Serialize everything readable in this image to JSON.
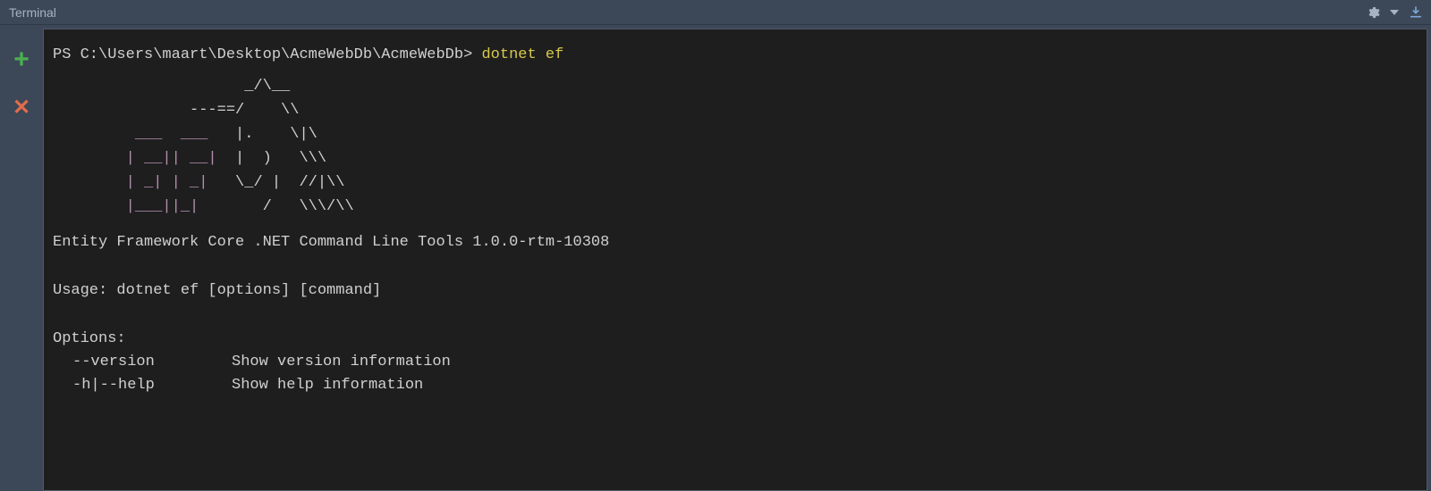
{
  "title": "Terminal",
  "prompt": "PS C:\\Users\\maart\\Desktop\\AcmeWebDb\\AcmeWebDb> ",
  "command": "dotnet ef",
  "ascii": {
    "lines": [
      {
        "plain": "                     _/\\__"
      },
      {
        "plain": "               ---==/    \\\\"
      },
      {
        "purple": "         ___  ___  ",
        "plain": " |.    \\|\\"
      },
      {
        "purple": "        | __|| __| ",
        "plain": " |  )   \\\\\\"
      },
      {
        "purple": "        | _| | _|  ",
        "plain": " \\_/ |  //|\\\\"
      },
      {
        "purple": "        |___||_|   ",
        "plain": "    /   \\\\\\/\\\\"
      }
    ]
  },
  "toolDescription": "Entity Framework Core .NET Command Line Tools 1.0.0-rtm-10308",
  "usage": "Usage: dotnet ef [options] [command]",
  "optionsHeader": "Options:",
  "options": [
    {
      "flag": "--version",
      "desc": "Show version information"
    },
    {
      "flag": "-h|--help",
      "desc": "Show help information"
    }
  ],
  "icons": {
    "gear": "gear-icon",
    "dropdown": "dropdown-icon",
    "download": "download-icon",
    "plus": "plus-icon",
    "close": "close-icon"
  }
}
